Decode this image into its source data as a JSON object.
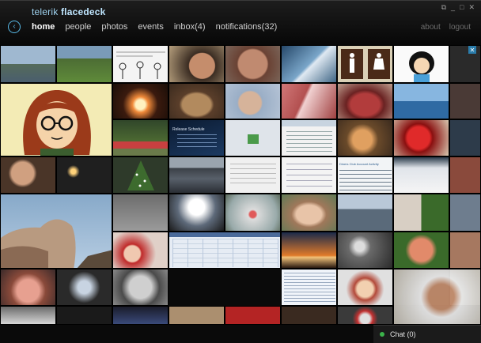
{
  "app": {
    "brand_first": "telerik",
    "brand_second": "flacedeck"
  },
  "nav": {
    "back_label": "‹",
    "items": [
      "home",
      "people",
      "photos",
      "events",
      "inbox(4)",
      "notifications(32)"
    ],
    "active": "home",
    "right": [
      "about",
      "logout"
    ]
  },
  "window_buttons": [
    "⧉",
    "_",
    "□",
    "✕"
  ],
  "close_label": "✕",
  "tiles": [
    {
      "bg": "#6f8fae"
    },
    {
      "bg": "#4e7b38"
    },
    {
      "bg": "#f2f2f2"
    },
    {
      "bg": "#efefef"
    },
    {
      "bg": "#b59a7c"
    },
    {
      "bg": "#a57560"
    },
    {
      "bg": "#466a8c"
    },
    {
      "bg": "#d7c8a6"
    },
    {
      "bg": "#f5f5f5"
    },
    {
      "bg": "#2c2c2c"
    },
    {
      "bg": "#f3ebb5"
    },
    {
      "bg": "#3a2012"
    },
    {
      "bg": "#4a3a2a"
    },
    {
      "bg": "#9aa8bc"
    },
    {
      "bg": "#b36a6a"
    },
    {
      "bg": "#983c3c"
    },
    {
      "bg": "#3b77b0"
    },
    {
      "bg": "#4a3a36"
    },
    {
      "bg": "#3c4f2a"
    },
    {
      "bg": "#12273f"
    },
    {
      "bg": "#d8dee8"
    },
    {
      "bg": "#c68a4c"
    },
    {
      "bg": "#c02424"
    },
    {
      "bg": "#2d3b4a"
    },
    {
      "bg": "#4a3528"
    },
    {
      "bg": "#1f1f1f"
    },
    {
      "bg": "#2e4c2a"
    },
    {
      "bg": "#6a6a6a"
    },
    {
      "bg": "#f0f0f0"
    },
    {
      "bg": "#f4f4f4"
    },
    {
      "bg": "#cfd6de"
    },
    {
      "bg": "#8a4a3c"
    },
    {
      "bg": "#87a9c9"
    },
    {
      "bg": "#666666"
    },
    {
      "bg": "#5e6a7a"
    },
    {
      "bg": "#cfcfcf"
    },
    {
      "bg": "#5f7a56"
    },
    {
      "bg": "#eaeaea"
    },
    {
      "bg": "#d8cfc4"
    },
    {
      "bg": "#6e7d8e"
    },
    {
      "bg": "#a67860"
    },
    {
      "bg": "#dcdcdc"
    },
    {
      "bg": "#e7a090"
    },
    {
      "bg": "#dfe7f2"
    },
    {
      "bg": "#2a1a18"
    },
    {
      "bg": "#8b7352"
    },
    {
      "bg": "#1a1a1a"
    },
    {
      "bg": "#5e7a3c"
    },
    {
      "bg": "#b34a3a"
    },
    {
      "bg": "#3c3c3c"
    },
    {
      "bg": "#d6d6d6"
    },
    {
      "bg": "#e8eef6"
    },
    {
      "bg": "#8a5a3a"
    },
    {
      "bg": "#ab8f6f"
    },
    {
      "bg": "#3e3e3e"
    },
    {
      "bg": "#b7b2a7"
    },
    {
      "bg": "#1a1c2a"
    },
    {
      "bg": "#b42424"
    },
    {
      "bg": "#3a2a20"
    },
    {
      "bg": "#2a2a2a"
    }
  ],
  "screenshots": {
    "release_title": "Release Schedule",
    "diners_title": "Diners Club Account Activity"
  },
  "chat": {
    "label": "Chat (0)"
  },
  "colors": {
    "accent": "#58b9e6",
    "online": "#3bb24a"
  }
}
